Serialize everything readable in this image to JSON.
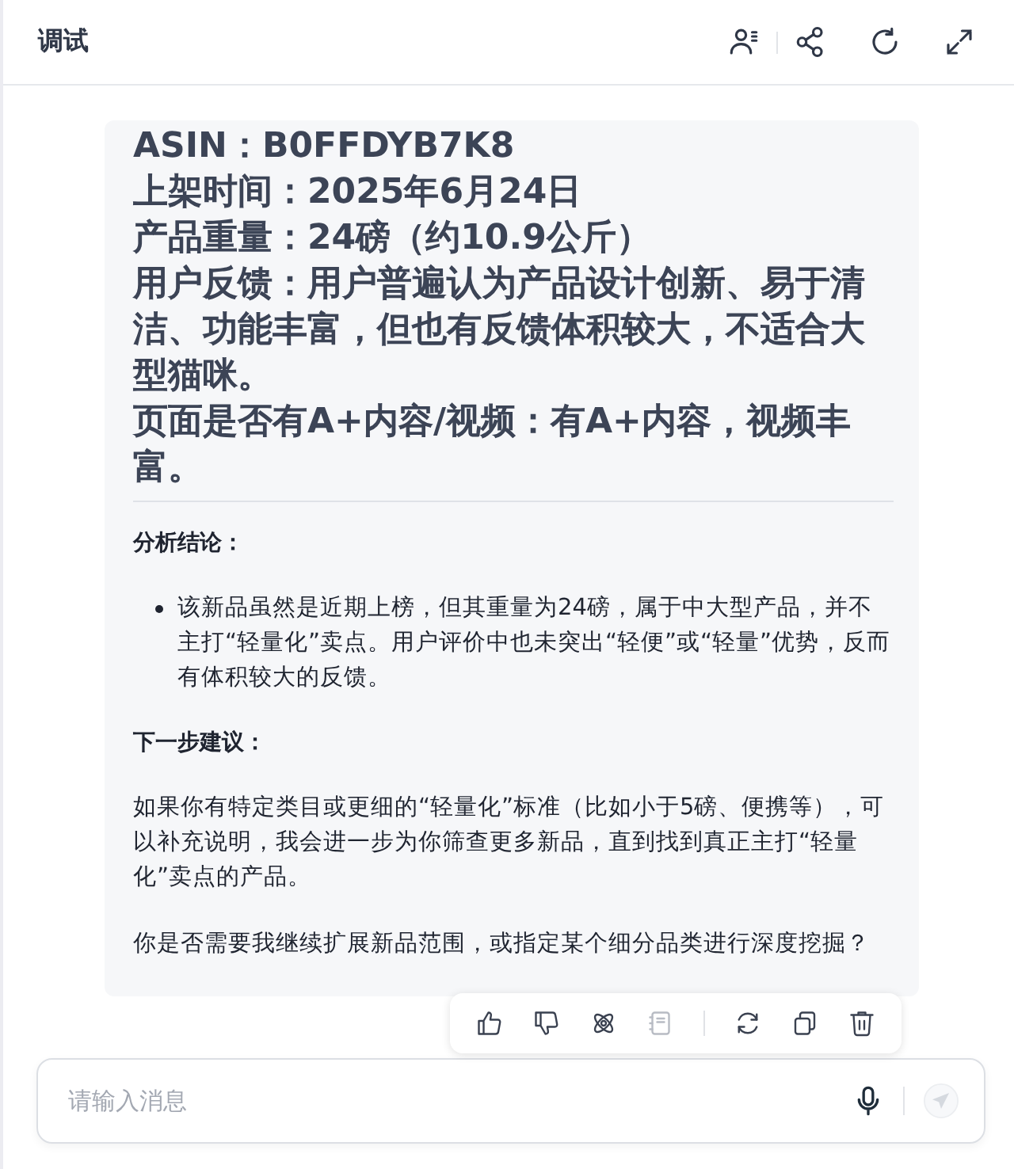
{
  "header": {
    "title": "调试",
    "tools": [
      {
        "kind": "persona"
      },
      {
        "kind": "share"
      },
      {
        "kind": "refresh"
      },
      {
        "kind": "expand"
      }
    ]
  },
  "message": {
    "facts": [
      "ASIN：B0FFDYB7K8",
      "上架时间：2025年6月24日",
      "产品重量：24磅（约10.9公斤）",
      "用户反馈：用户普遍认为产品设计创新、易于清洁、功能丰富，但也有反馈体积较大，不适合大型猫咪。",
      "页面是否有A+内容/视频：有A+内容，视频丰富。"
    ],
    "blocks": [
      {
        "kind": "heading",
        "text": "分析结论："
      },
      {
        "kind": "bullet",
        "text": "该新品虽然是近期上榜，但其重量为24磅，属于中大型产品，并不主打“轻量化”卖点。用户评价中也未突出“轻便”或“轻量”优势，反而有体积较大的反馈。"
      },
      {
        "kind": "heading",
        "text": "下一步建议："
      },
      {
        "kind": "paragraph",
        "text": "如果你有特定类目或更细的“轻量化”标准（比如小于5磅、便携等），可以补充说明，我会进一步为你筛查更多新品，直到找到真正主打“轻量化”卖点的产品。"
      },
      {
        "kind": "paragraph",
        "text": "你是否需要我继续扩展新品范围，或指定某个细分品类进行深度挖掘？"
      }
    ]
  },
  "actions": [
    {
      "kind": "like",
      "disabled": false
    },
    {
      "kind": "dislike",
      "disabled": false
    },
    {
      "kind": "atom",
      "disabled": false
    },
    {
      "kind": "note",
      "disabled": true
    },
    {
      "kind": "regenerate",
      "disabled": false
    },
    {
      "kind": "copy",
      "disabled": false
    },
    {
      "kind": "delete",
      "disabled": false
    }
  ],
  "input": {
    "placeholder": "请输入消息"
  },
  "send": {
    "disabled": true
  }
}
